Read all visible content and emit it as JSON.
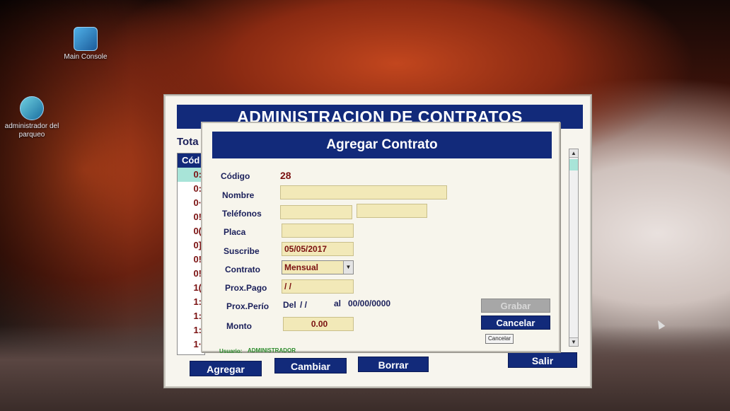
{
  "desktop": {
    "icons": [
      {
        "label": "Main Console",
        "icon": "main-console-icon"
      },
      {
        "label": "administrador del parqueo",
        "icon": "admin-parqueo-icon"
      }
    ]
  },
  "main_window": {
    "title": "ADMINISTRACION DE CONTRATOS",
    "total_label": "Tota",
    "list_header": "Cód",
    "list_rows": [
      "0:",
      "0:",
      "0·",
      "0!",
      "0(",
      "0]",
      "0!",
      "0!",
      "1(",
      "1:",
      "1:",
      "1:",
      "1·",
      "1!"
    ],
    "buttons": {
      "add": "Agregar",
      "change": "Cambiar",
      "delete": "Borrar",
      "exit": "Salir"
    }
  },
  "dialog": {
    "title": "Agregar Contrato",
    "fields": {
      "codigo_label": "Código",
      "codigo_value": "28",
      "nombre_label": "Nombre",
      "nombre_value": "",
      "telefonos_label": "Teléfonos",
      "telefono1_value": "",
      "telefono2_value": "",
      "placa_label": "Placa",
      "placa_value": "",
      "suscribe_label": "Suscribe",
      "suscribe_value": "05/05/2017",
      "contrato_label": "Contrato",
      "contrato_value": "Mensual",
      "prox_pago_label": "Prox.Pago",
      "prox_pago_value": " / /",
      "prox_periodo_label": "Prox.Perío",
      "periodo_del_label": "Del",
      "periodo_del_value": " /  /",
      "periodo_al_label": "al",
      "periodo_al_value": "00/00/0000",
      "monto_label": "Monto",
      "monto_value": "0.00"
    },
    "buttons": {
      "save": "Grabar",
      "cancel": "Cancelar",
      "cancel_small": "Cancelar"
    },
    "status": {
      "user_label": "Usuario:",
      "user_value": "ADMINISTRADOR"
    }
  }
}
